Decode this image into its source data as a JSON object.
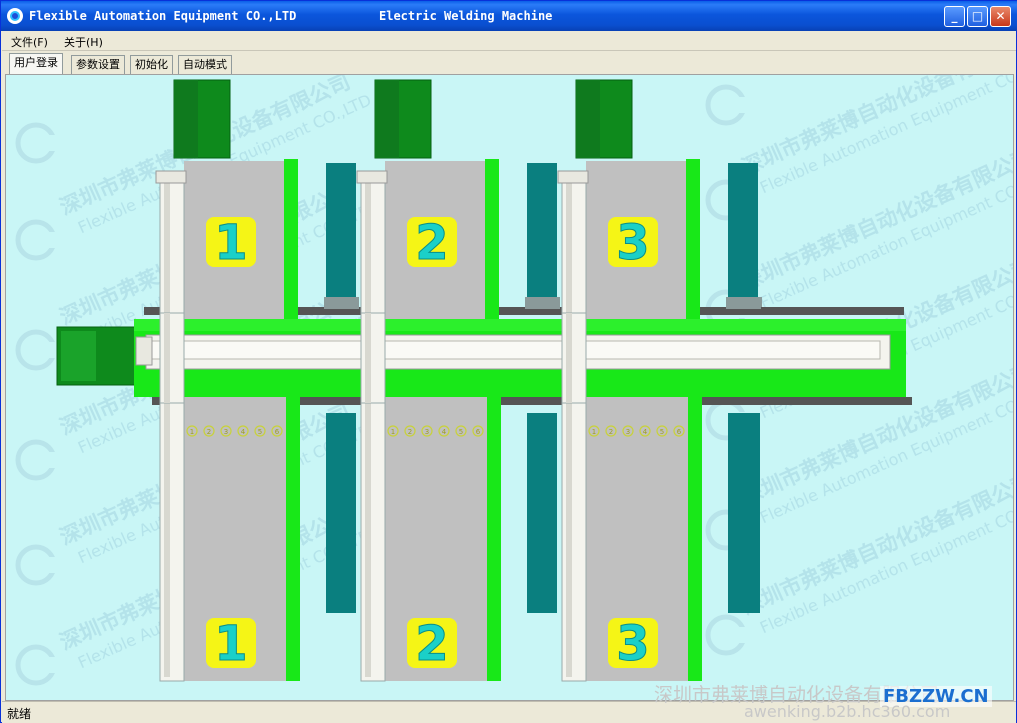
{
  "window": {
    "title_left": "Flexible Automation Equipment CO.,LTD",
    "title_right": "Electric Welding Machine",
    "minimize_glyph": "_",
    "maximize_glyph": "□",
    "close_glyph": "✕"
  },
  "menu": {
    "items": [
      "文件(F)",
      "关于(H)"
    ]
  },
  "tabs": [
    {
      "label": "用户登录",
      "active": true
    },
    {
      "label": "参数设置",
      "active": false
    },
    {
      "label": "初始化",
      "active": false
    },
    {
      "label": "自动模式",
      "active": false
    }
  ],
  "stations": [
    {
      "top_number": "1",
      "bottom_number": "1"
    },
    {
      "top_number": "2",
      "bottom_number": "2"
    },
    {
      "top_number": "3",
      "bottom_number": "3"
    }
  ],
  "position_markers": [
    "1",
    "2",
    "3",
    "4",
    "5",
    "6"
  ],
  "canvas_watermark": {
    "cn": "深圳市弗莱博自动化设备有限公司",
    "en": "Flexible Automation Equipment CO.,LTD",
    "logo": "FAE"
  },
  "status": {
    "text": "就绪"
  },
  "overlay_watermark": {
    "cn": "深圳市弗莱博自动化设备有限公司",
    "site": "FBZZW.CN",
    "url": "awenking.b2b.hc360.com"
  },
  "colors": {
    "canvas_bg": "#c9f6f6",
    "green": "#18e818",
    "dark_green": "#0e8a1c",
    "teal": "#0a7f7f",
    "gray": "#c0c0c0",
    "number_bg": "#f5f516",
    "number_fg": "#1ad0c8",
    "titlebar": "#0a4fd0"
  }
}
